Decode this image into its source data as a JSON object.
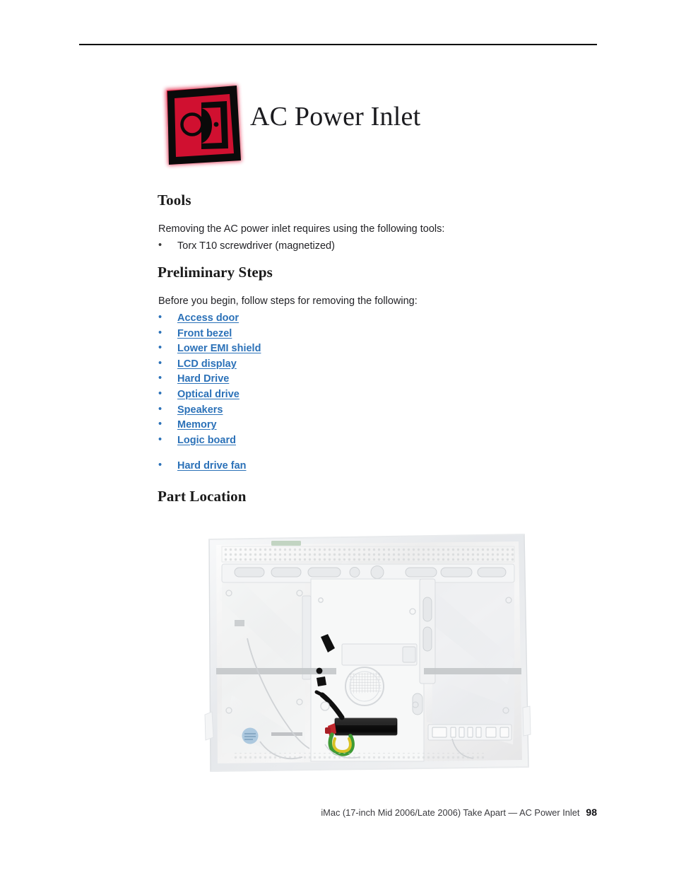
{
  "document": {
    "page_title": "AC Power Inlet",
    "icon_name": "apple-service-chapter-icon",
    "icon_colors": {
      "fill": "#d01030",
      "stroke": "#000000"
    }
  },
  "sections": {
    "tools": {
      "heading": "Tools",
      "intro": "Removing the AC power inlet requires using the following tools:",
      "items": [
        {
          "label": "Torx T10 screwdriver (magnetized)",
          "is_link": false
        }
      ]
    },
    "preliminary_steps": {
      "heading": "Preliminary Steps",
      "intro": "Before you begin, follow steps for removing the following:",
      "items": [
        {
          "label": "Access door",
          "is_link": true,
          "spaced": false
        },
        {
          "label": "Front bezel",
          "is_link": true,
          "spaced": false
        },
        {
          "label": "Lower EMI shield",
          "is_link": true,
          "spaced": false
        },
        {
          "label": "LCD display",
          "is_link": true,
          "spaced": false
        },
        {
          "label": "Hard Drive",
          "is_link": true,
          "spaced": false
        },
        {
          "label": "Optical drive",
          "is_link": true,
          "spaced": false
        },
        {
          "label": "Speakers",
          "is_link": true,
          "spaced": false
        },
        {
          "label": "Memory",
          "is_link": true,
          "spaced": false
        },
        {
          "label": "Logic board",
          "is_link": true,
          "spaced": false
        },
        {
          "label": "Hard drive fan",
          "is_link": true,
          "spaced": true
        }
      ]
    },
    "part_location": {
      "heading": "Part Location",
      "figure_name": "imac-rear-chassis-ac-power-inlet-photo"
    }
  },
  "bullet_glyph": "•",
  "link_color": "#2b71b8",
  "footer": {
    "text": "iMac (17-inch Mid 2006/Late 2006) Take Apart  —  AC Power Inlet",
    "page_number": "98"
  }
}
